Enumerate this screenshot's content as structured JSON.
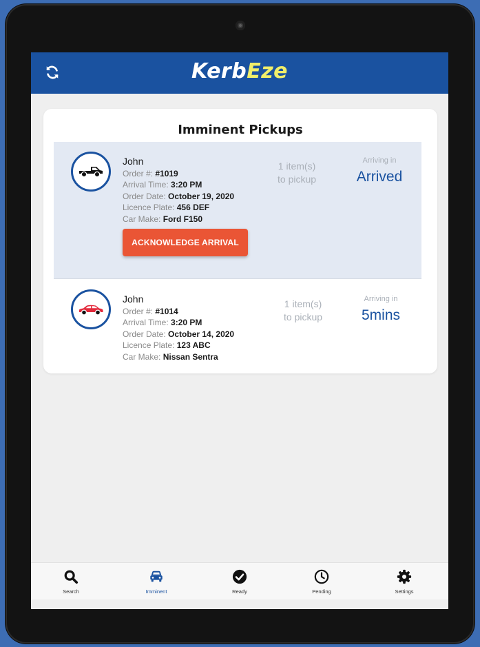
{
  "app": {
    "logo_part1": "Kerb",
    "logo_part2": "Eze"
  },
  "colors": {
    "brand_blue": "#1a52a0",
    "accent_yellow": "#f0ee6a",
    "action_orange": "#ea5535"
  },
  "card": {
    "title": "Imminent Pickups"
  },
  "orders": [
    {
      "name": "John",
      "order_label": "Order #: ",
      "order_number": "#1019",
      "arrival_label": "Arrival Time: ",
      "arrival_time": "3:20 PM",
      "date_label": "Order Date: ",
      "order_date": "October 19, 2020",
      "plate_label": "Licence Plate: ",
      "plate": "456 DEF",
      "make_label": "Car Make: ",
      "make": "Ford F150",
      "items_line1": "1 item(s)",
      "items_line2": "to pickup",
      "arriving_label": "Arriving in",
      "arriving_value": "Arrived",
      "vehicle_icon": "pickup-truck-icon",
      "action_label": "ACKNOWLEDGE ARRIVAL"
    },
    {
      "name": "John",
      "order_label": "Order #: ",
      "order_number": "#1014",
      "arrival_label": "Arrival Time: ",
      "arrival_time": "3:20 PM",
      "date_label": "Order Date: ",
      "order_date": "October 14, 2020",
      "plate_label": "Licence Plate: ",
      "plate": "123 ABC",
      "make_label": "Car Make: ",
      "make": "Nissan Sentra",
      "items_line1": "1 item(s)",
      "items_line2": "to pickup",
      "arriving_label": "Arriving in",
      "arriving_value": "5mins",
      "vehicle_icon": "sedan-icon"
    }
  ],
  "nav": [
    {
      "label": "Search",
      "icon": "search-icon"
    },
    {
      "label": "Imminent",
      "icon": "car-icon",
      "active": true
    },
    {
      "label": "Ready",
      "icon": "check-circle-icon"
    },
    {
      "label": "Pending",
      "icon": "clock-icon"
    },
    {
      "label": "Settings",
      "icon": "gear-icon"
    }
  ]
}
